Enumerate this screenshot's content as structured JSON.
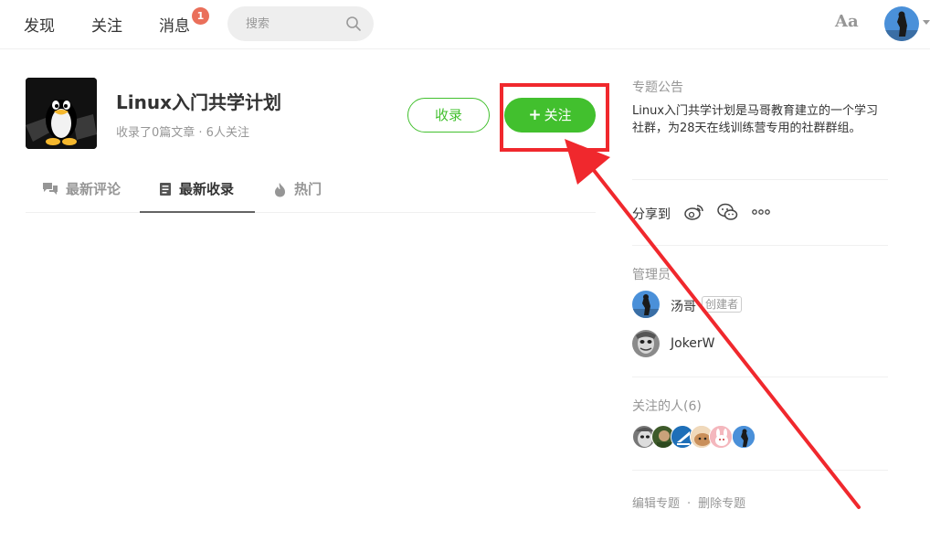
{
  "nav": {
    "discover": "发现",
    "follow": "关注",
    "messages": "消息",
    "messages_badge": "1",
    "search_placeholder": "搜索",
    "font_toggle": "Aa"
  },
  "collection": {
    "title": "Linux入门共学计划",
    "meta": "收录了0篇文章 · 6人关注",
    "collect_label": "收录",
    "follow_label": "关注",
    "follow_plus": "+"
  },
  "tabs": [
    {
      "label": "最新评论",
      "icon": "comment-icon"
    },
    {
      "label": "最新收录",
      "icon": "document-icon"
    },
    {
      "label": "热门",
      "icon": "fire-icon"
    }
  ],
  "sidebar": {
    "notice_heading": "专题公告",
    "notice_text": "Linux入门共学计划是马哥教育建立的一个学习社群，为28天在线训练营专用的社群群组。",
    "share_label": "分享到",
    "admins_heading": "管理员",
    "admins": [
      {
        "name": "汤哥",
        "tag": "创建者"
      },
      {
        "name": "JokerW",
        "tag": ""
      }
    ],
    "followers_heading": "关注的人(6)",
    "edit_link": "编辑专题",
    "footer_sep": "·",
    "delete_link": "删除专题"
  },
  "colors": {
    "accent_green": "#42c02e",
    "badge_red": "#ea6f5a",
    "annotation_red": "#f0282d"
  }
}
